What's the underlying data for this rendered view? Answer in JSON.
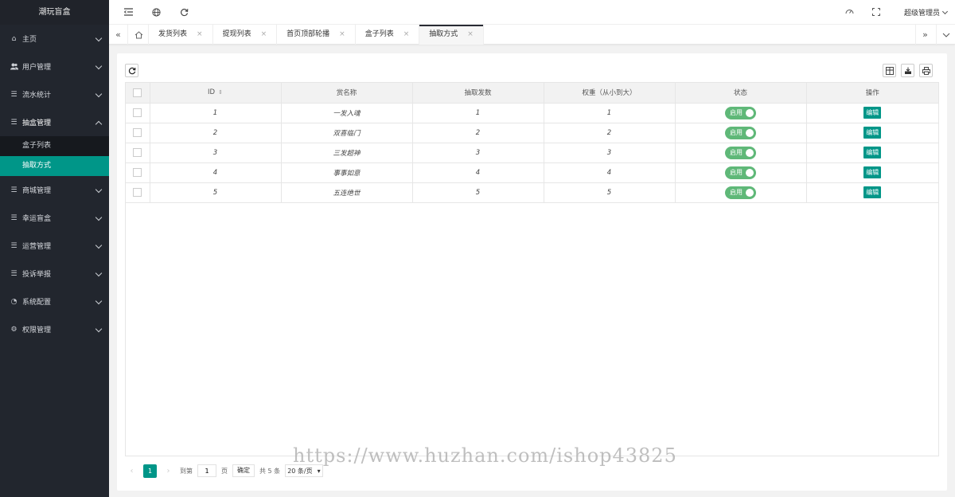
{
  "sidebar": {
    "logo": "潮玩盲盒",
    "items": [
      {
        "label": "主页",
        "icon": "home-icon",
        "glyph": "⌂"
      },
      {
        "label": "用户管理",
        "icon": "users-icon",
        "glyph": "👥"
      },
      {
        "label": "流水统计",
        "icon": "list-icon",
        "glyph": "☰"
      },
      {
        "label": "抽盒管理",
        "icon": "list-icon",
        "glyph": "☰"
      },
      {
        "label": "商城管理",
        "icon": "list-icon",
        "glyph": "☰"
      },
      {
        "label": "幸运盲盒",
        "icon": "list-icon",
        "glyph": "☰"
      },
      {
        "label": "运营管理",
        "icon": "list-icon",
        "glyph": "☰"
      },
      {
        "label": "投诉举报",
        "icon": "list-icon",
        "glyph": "☰"
      },
      {
        "label": "系统配置",
        "icon": "settings-circle-icon",
        "glyph": "◔"
      },
      {
        "label": "权限管理",
        "icon": "gear-icon",
        "glyph": "⚙"
      }
    ],
    "sub_items": [
      {
        "label": "盒子列表"
      },
      {
        "label": "抽取方式"
      }
    ]
  },
  "header": {
    "user": "超级管理员"
  },
  "tabs": [
    {
      "label": "发货列表"
    },
    {
      "label": "提现列表"
    },
    {
      "label": "首页顶部轮播"
    },
    {
      "label": "盒子列表"
    },
    {
      "label": "抽取方式"
    }
  ],
  "table": {
    "columns": [
      "ID",
      "赏名称",
      "抽取发数",
      "权重（从小到大）",
      "状态",
      "操作"
    ],
    "rows": [
      {
        "id": "1",
        "name": "一发入魂",
        "count": "1",
        "weight": "1",
        "status": "启用",
        "action": "编辑"
      },
      {
        "id": "2",
        "name": "双喜临门",
        "count": "2",
        "weight": "2",
        "status": "启用",
        "action": "编辑"
      },
      {
        "id": "3",
        "name": "三发超神",
        "count": "3",
        "weight": "3",
        "status": "启用",
        "action": "编辑"
      },
      {
        "id": "4",
        "name": "事事如意",
        "count": "4",
        "weight": "4",
        "status": "启用",
        "action": "编辑"
      },
      {
        "id": "5",
        "name": "五连绝世",
        "count": "5",
        "weight": "5",
        "status": "启用",
        "action": "编辑"
      }
    ]
  },
  "pager": {
    "current": "1",
    "goto_label": "到第",
    "goto_value": "1",
    "page_unit": "页",
    "confirm": "确定",
    "total": "共 5 条",
    "page_size": "20 条/页"
  },
  "watermark": "https://www.huzhan.com/ishop43825",
  "colors": {
    "accent": "#009688",
    "switch_on": "#5fb878",
    "sidebar_bg": "#22262e"
  }
}
